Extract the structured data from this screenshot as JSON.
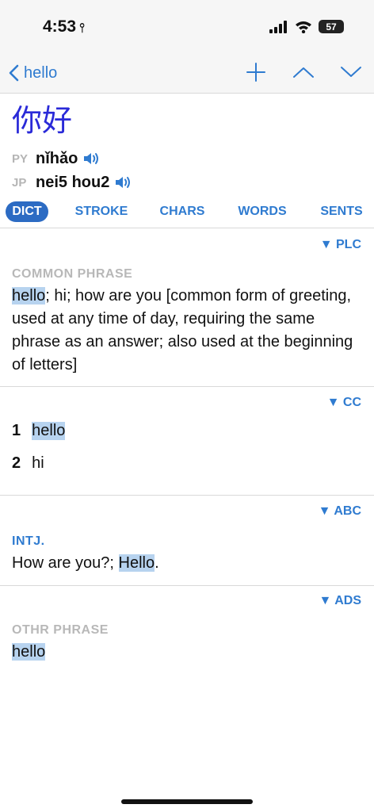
{
  "status": {
    "time": "4:53",
    "battery": "57"
  },
  "nav": {
    "back_label": "hello",
    "icons": [
      "chevron-left-icon",
      "plus-icon",
      "chevron-up-icon",
      "chevron-down-icon"
    ]
  },
  "entry": {
    "headword": "你好",
    "readings": [
      {
        "tag": "PY",
        "text": "nǐhǎo"
      },
      {
        "tag": "JP",
        "text": "nei5 hou2"
      }
    ]
  },
  "tabs": [
    "DICT",
    "STROKE",
    "CHARS",
    "WORDS",
    "SENTS"
  ],
  "active_tab": "DICT",
  "sections": {
    "plc": {
      "source": "▼ PLC",
      "category": "COMMON PHRASE",
      "highlight": "hello",
      "rest": "; hi; how are you [common form of greeting, used at any time of day, requiring the same phrase as an answer; also used at the beginning of letters]"
    },
    "cc": {
      "source": "▼ CC",
      "senses": [
        {
          "num": "1",
          "text": "hello"
        },
        {
          "num": "2",
          "text": "hi"
        }
      ]
    },
    "abc": {
      "source": "▼ ABC",
      "category": "INTJ.",
      "before": "How are you?; ",
      "highlight": "Hello",
      "after": "."
    },
    "ads": {
      "source": "▼ ADS",
      "category": "OTHR PHRASE",
      "highlight": "hello"
    }
  },
  "colors": {
    "accent": "#2f7bd0",
    "headword": "#2a2ad8",
    "highlight": "#b7d3ef"
  }
}
